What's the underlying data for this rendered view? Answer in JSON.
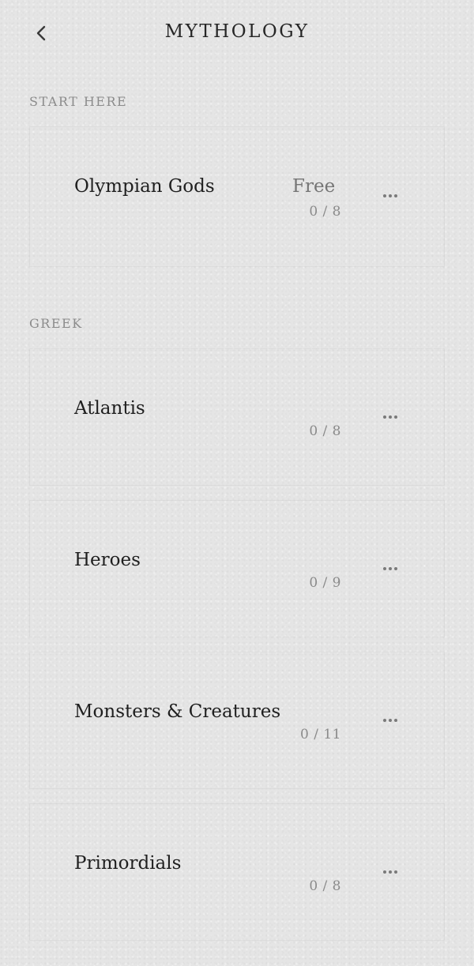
{
  "header": {
    "title": "MYTHOLOGY",
    "back_icon": "chevron-left-icon"
  },
  "sections": [
    {
      "label": "START HERE",
      "items": [
        {
          "title": "Olympian Gods",
          "price": "Free",
          "progress": "0 / 8",
          "menu_icon": "more-horizontal-icon"
        }
      ]
    },
    {
      "label": "GREEK",
      "items": [
        {
          "title": "Atlantis",
          "progress": "0 / 8",
          "menu_icon": "more-horizontal-icon"
        },
        {
          "title": "Heroes",
          "progress": "0 / 9",
          "menu_icon": "more-horizontal-icon"
        },
        {
          "title": "Monsters & Creatures",
          "progress": "0 / 11",
          "menu_icon": "more-horizontal-icon"
        },
        {
          "title": "Primordials",
          "progress": "0 / 8",
          "menu_icon": "more-horizontal-icon"
        }
      ]
    }
  ],
  "colors": {
    "background": "#e5e5e5",
    "text": "#1f1f1f",
    "muted": "#8a8a8a"
  }
}
